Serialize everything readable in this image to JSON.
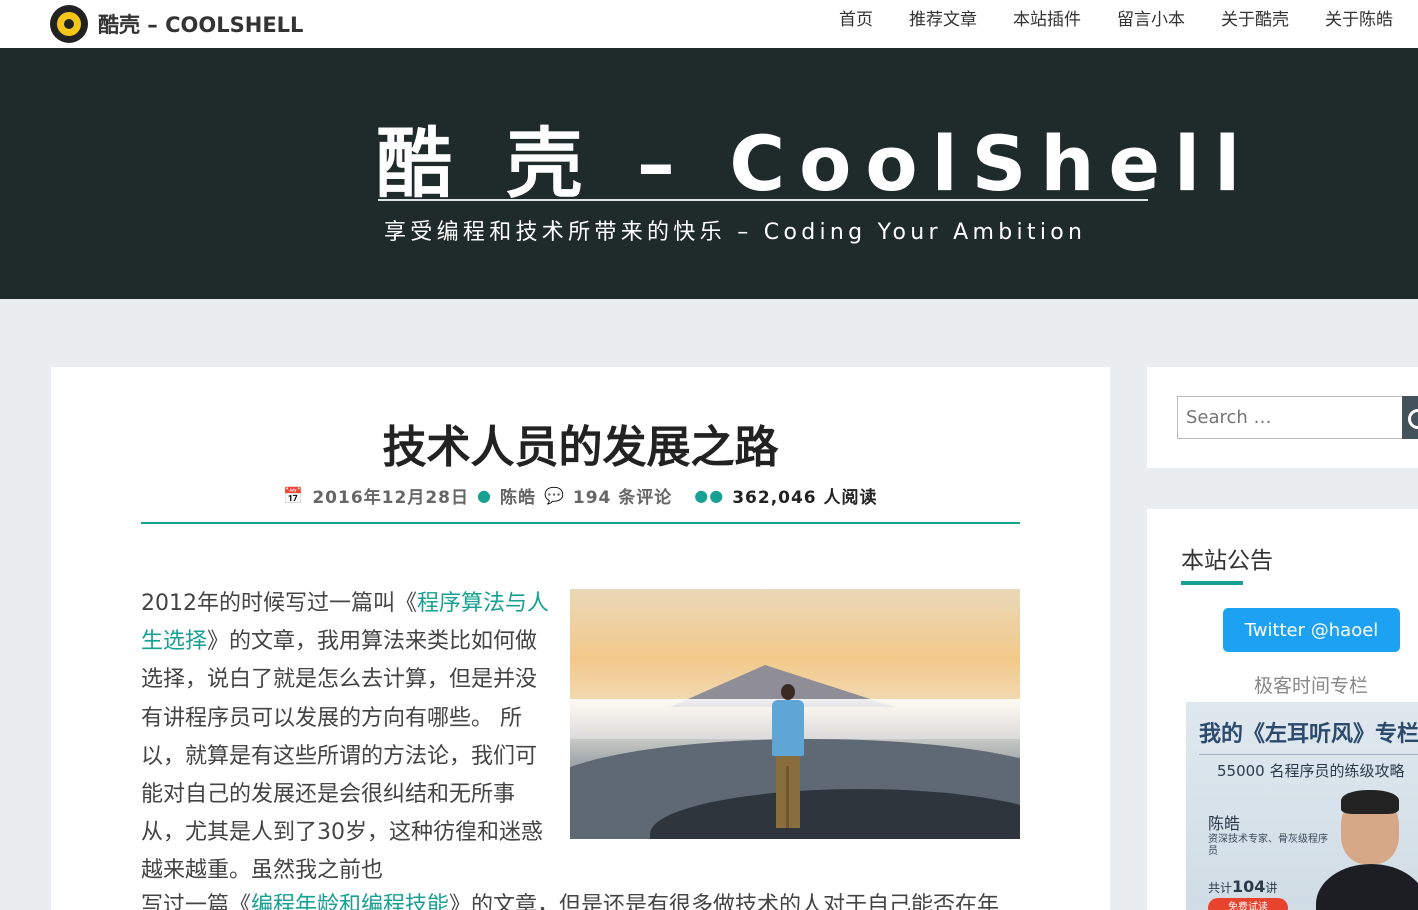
{
  "site": {
    "logo_text": "酷壳 – COOLSHELL",
    "nav": [
      "首页",
      "推荐文章",
      "本站插件",
      "留言小本",
      "关于酷壳",
      "关于陈皓"
    ]
  },
  "hero": {
    "title": "酷 壳 – CoolShell",
    "tagline": "享受编程和技术所带来的快乐 – Coding Your Ambition"
  },
  "post": {
    "title": "技术人员的发展之路",
    "date": "2016年12月28日",
    "author": "陈皓",
    "comments": "194 条评论",
    "reads": "362,046 人阅读",
    "body": {
      "p1_before": "2012年的时候写过一篇叫《",
      "p1_link": "程序算法与人生选择",
      "p1_after": "》的文章，我用算法来类比如何做选择，说白了就是怎么去计算，但是并没有讲程序员可以发展的方向有哪些。 所以，就算是有这些所谓的方法论，我们可能对自己的发展还是会很纠结和无所事从，尤其是人到了30岁，这种彷徨和迷惑越来越重。虽然我之前也",
      "p2_before": "写过一篇《",
      "p2_link": "编程年龄和编程技能",
      "p2_after": "》的文章，但是还是有很多做技术的人对于自己能否在年"
    }
  },
  "sidebar": {
    "search_placeholder": "Search …",
    "notice_title": "本站公告",
    "twitter_label": "Twitter @haoel",
    "geek_label": "极客时间专栏",
    "promo": {
      "title": "我的《左耳听风》专栏",
      "subtitle": "55000 名程序员的练级攻略",
      "name": "陈皓",
      "desc": "资深技术专家、骨灰级程序员",
      "count_prefix": "共计",
      "count_num": "104",
      "count_suffix": "讲",
      "trial": "免费试读"
    }
  },
  "colors": {
    "accent": "#17a193",
    "hero_bg": "#1f2a2a",
    "page_bg": "#e9edf0",
    "twitter": "#1da1f2"
  }
}
